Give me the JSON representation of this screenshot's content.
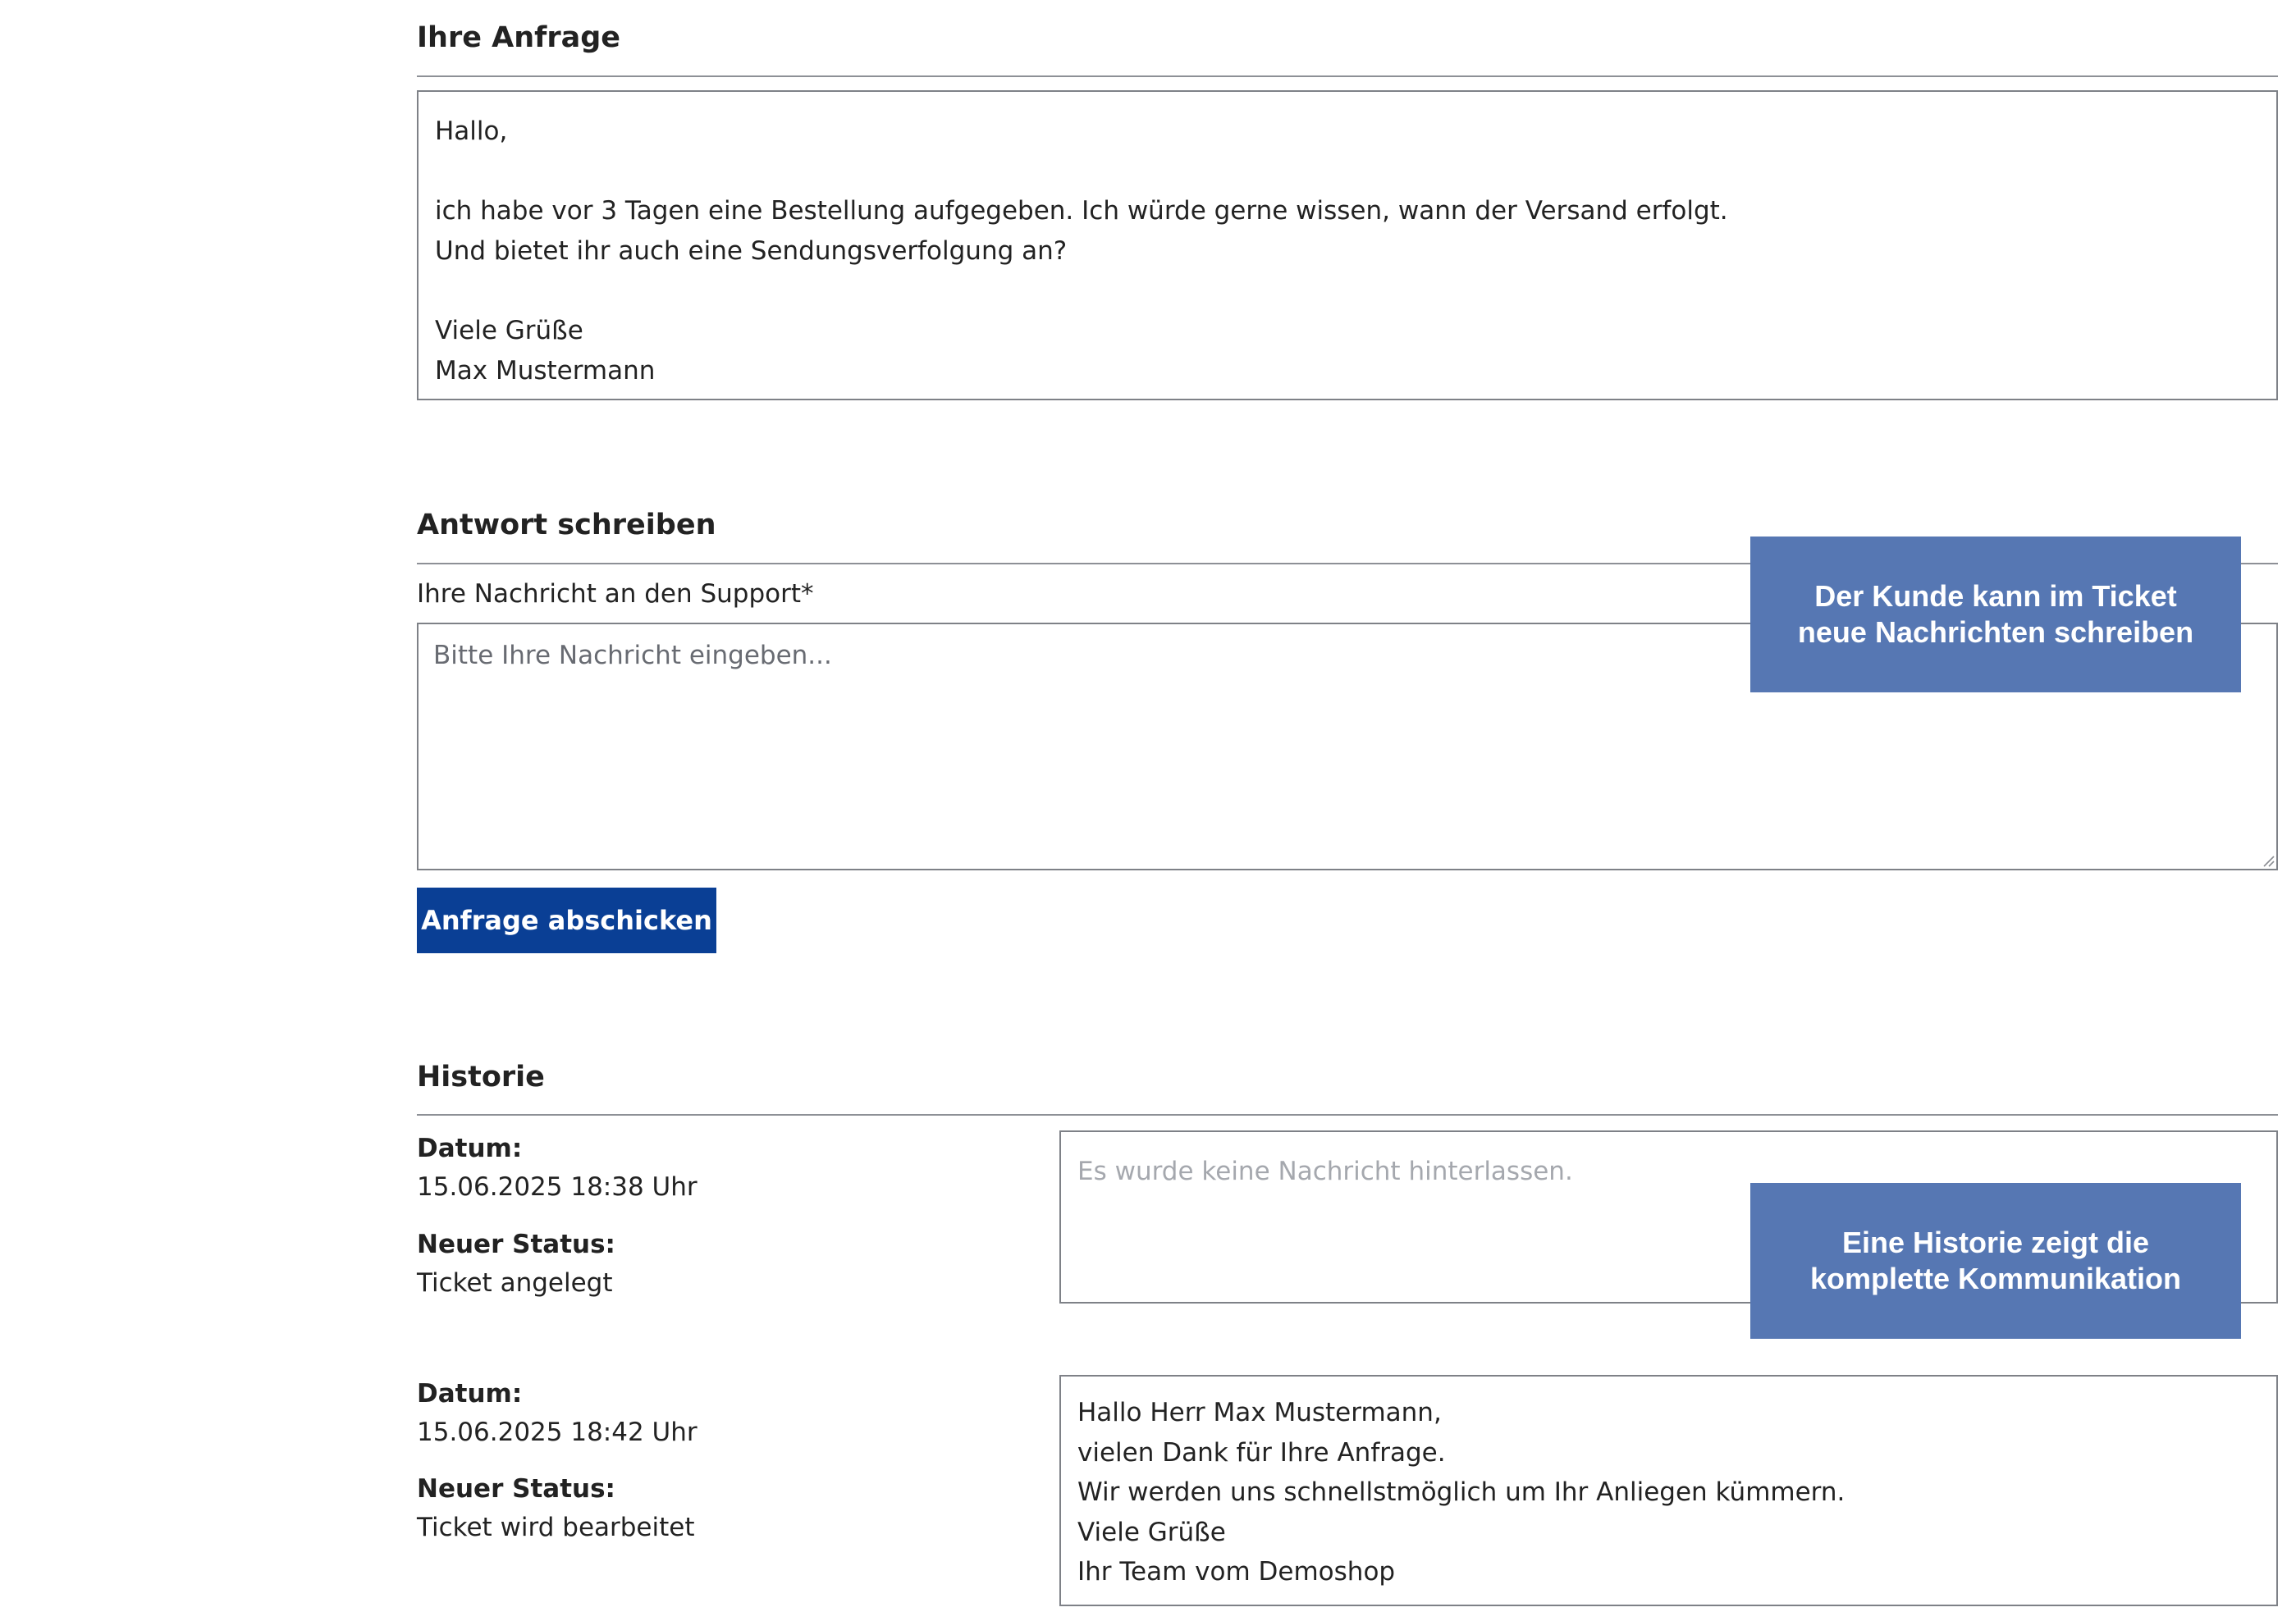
{
  "request": {
    "heading": "Ihre Anfrage",
    "lines": [
      "Hallo,",
      "",
      "ich habe vor 3 Tagen eine Bestellung aufgegeben. Ich würde gerne wissen, wann der Versand erfolgt.",
      "Und bietet ihr auch eine Sendungsverfolgung an?",
      "",
      "Viele Grüße",
      "Max Mustermann"
    ]
  },
  "reply": {
    "heading": "Antwort schreiben",
    "field_label": "Ihre Nachricht an den Support*",
    "placeholder": "Bitte Ihre Nachricht eingeben...",
    "value": "",
    "submit_label": "Anfrage abschicken"
  },
  "history": {
    "heading": "Historie",
    "date_label": "Datum:",
    "status_label": "Neuer Status:",
    "entries": [
      {
        "date": "15.06.2025 18:38 Uhr",
        "status": "Ticket angelegt",
        "message_empty": "Es wurde keine Nachricht hinterlassen."
      },
      {
        "date": "15.06.2025 18:42 Uhr",
        "status": "Ticket wird bearbeitet",
        "message_lines": [
          "Hallo Herr Max Mustermann,",
          "vielen Dank für Ihre Anfrage.",
          "Wir werden uns schnellstmöglich um Ihr Anliegen kümmern.",
          "Viele Grüße",
          "Ihr Team vom Demoshop"
        ]
      }
    ]
  },
  "callouts": {
    "reply": [
      "Der Kunde kann im Ticket",
      "neue Nachrichten schreiben"
    ],
    "history": [
      "Eine Historie zeigt die",
      "komplette Kommunikation"
    ]
  },
  "colors": {
    "button": "#0a3f95",
    "callout": "#5677b3",
    "border": "#7e8187",
    "text": "#222222",
    "placeholder_muted": "#a5a8ae"
  }
}
